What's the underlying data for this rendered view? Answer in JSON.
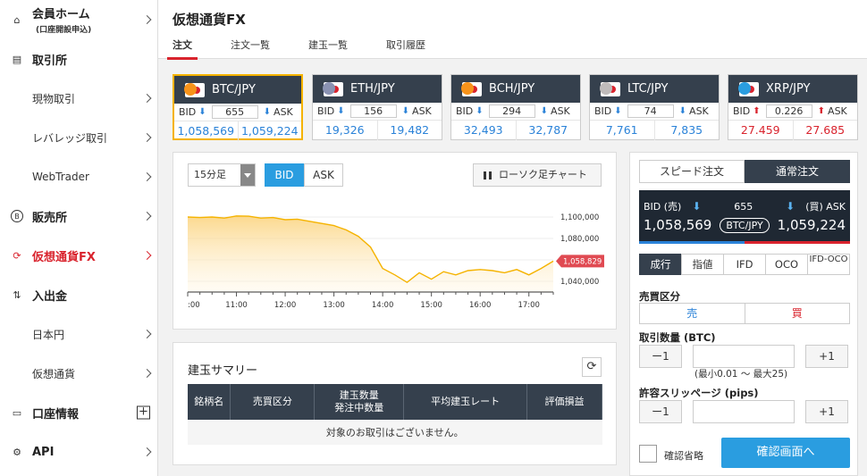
{
  "sidebar": {
    "home": {
      "label": "会員ホーム",
      "sub": "(口座開設申込)"
    },
    "exchange": {
      "label": "取引所"
    },
    "spot": {
      "label": "現物取引"
    },
    "leverage": {
      "label": "レバレッジ取引"
    },
    "webtrader": {
      "label": "WebTrader"
    },
    "shop": {
      "label": "販売所"
    },
    "fx": {
      "label": "仮想通貨FX"
    },
    "deposit": {
      "label": "入出金"
    },
    "jpy": {
      "label": "日本円"
    },
    "crypto": {
      "label": "仮想通貨"
    },
    "account": {
      "label": "口座情報"
    },
    "api": {
      "label": "API"
    }
  },
  "header": {
    "title": "仮想通貨FX",
    "tabs": [
      "注文",
      "注文一覧",
      "建玉一覧",
      "取引履歴"
    ]
  },
  "cards": [
    {
      "pair": "BTC/JPY",
      "spread": "655",
      "bid": "1,058,569",
      "ask": "1,059,224",
      "coin_color": "#f7931a",
      "trend": "down"
    },
    {
      "pair": "ETH/JPY",
      "spread": "156",
      "bid": "19,326",
      "ask": "19,482",
      "coin_color": "#8a92b2",
      "trend": "down"
    },
    {
      "pair": "BCH/JPY",
      "spread": "294",
      "bid": "32,493",
      "ask": "32,787",
      "coin_color": "#f7931a",
      "trend": "down"
    },
    {
      "pair": "LTC/JPY",
      "spread": "74",
      "bid": "7,761",
      "ask": "7,835",
      "coin_color": "#bfbbbb",
      "trend": "down"
    },
    {
      "pair": "XRP/JPY",
      "spread": "0.226",
      "bid": "27.459",
      "ask": "27.685",
      "coin_color": "#2a9de0",
      "trend": "up"
    }
  ],
  "card_labels": {
    "bid": "BID",
    "ask": "ASK"
  },
  "chart_controls": {
    "timeframe": "15分足",
    "bid": "BID",
    "ask": "ASK",
    "candle": "ローソク足チャート"
  },
  "chart_data": {
    "type": "area",
    "x": [
      "10:00",
      "10:15",
      "10:30",
      "10:45",
      "11:00",
      "11:15",
      "11:30",
      "11:45",
      "12:00",
      "12:15",
      "12:30",
      "12:45",
      "13:00",
      "13:15",
      "13:30",
      "13:45",
      "14:00",
      "14:15",
      "14:30",
      "14:45",
      "15:00",
      "15:15",
      "15:30",
      "15:45",
      "16:00",
      "16:15",
      "16:30",
      "16:45",
      "17:00",
      "17:15",
      "17:30"
    ],
    "values": [
      1100000,
      1099500,
      1100000,
      1099000,
      1101000,
      1100800,
      1099000,
      1099500,
      1097500,
      1098000,
      1096000,
      1094000,
      1092000,
      1088000,
      1082000,
      1072000,
      1052000,
      1046000,
      1039000,
      1048000,
      1042000,
      1049000,
      1046000,
      1050000,
      1051000,
      1050000,
      1048000,
      1051000,
      1046000,
      1052000,
      1058829
    ],
    "xticks": [
      ":00",
      "11:00",
      "12:00",
      "13:00",
      "14:00",
      "15:00",
      "16:00",
      "17:00"
    ],
    "ylim": [
      1030000,
      1110000
    ],
    "yticks": [
      1040000,
      1060000,
      1080000,
      1100000
    ],
    "ytick_labels": [
      "1,040,000",
      "1,060,000",
      "1,080,000",
      "1,100,000"
    ],
    "current_label": "1,058,829",
    "line_color": "#f5b300",
    "current_color": "#e04a52"
  },
  "summary": {
    "title": "建玉サマリー",
    "columns": [
      [
        "銘柄名"
      ],
      [
        "売買区分"
      ],
      [
        "建玉数量",
        "発注中数量"
      ],
      [
        "平均建玉レート"
      ],
      [
        "評価損益"
      ]
    ],
    "empty": "対象のお取引はございません。"
  },
  "order": {
    "tabs": [
      "スピード注文",
      "通常注文"
    ],
    "bid_label": "BID (売)",
    "ask_label": "(買) ASK",
    "spread": "655",
    "bid": "1,058,569",
    "ask": "1,059,224",
    "pair": "BTC/JPY",
    "types": [
      "成行",
      "指値",
      "IFD",
      "OCO",
      "IFD-OCO"
    ],
    "side_label": "売買区分",
    "sell": "売",
    "buy": "買",
    "qty_label": "取引数量 (BTC)",
    "minus": "ー1",
    "plus": "+1",
    "qty_hint": "(最小0.01 〜 最大25)",
    "slip_label": "許容スリッページ (pips)",
    "skip_label": "確認省略",
    "confirm": "確認画面へ"
  }
}
